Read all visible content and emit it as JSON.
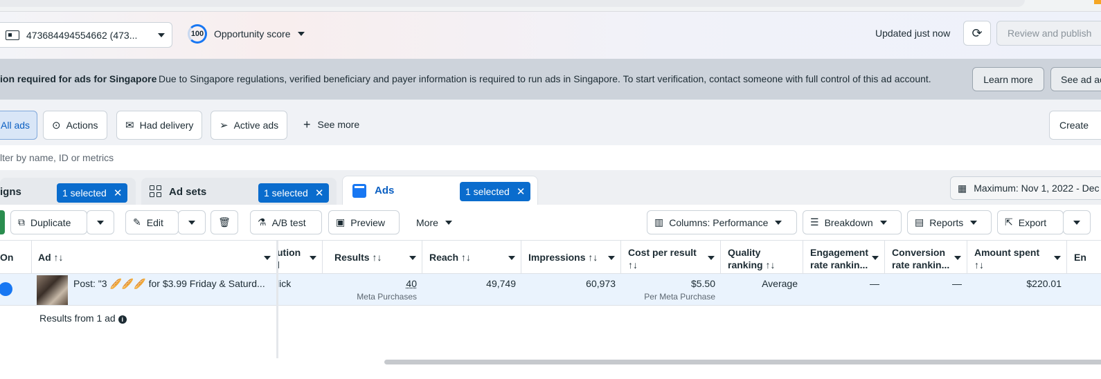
{
  "topbar": {
    "account_label": "473684494554662 (473...",
    "opportunity_score": "100",
    "opportunity_label": "Opportunity score",
    "updated_text": "Updated just now",
    "review_label": "Review and publish"
  },
  "banner": {
    "title": "ion required for ads for Singapore",
    "message": "Due to Singapore regulations, verified beneficiary and payer information is required to run ads in Singapore. To start verification, contact someone with full control of this ad account.",
    "learn_more": "Learn more",
    "see_ad": "See ad account"
  },
  "filters": {
    "all_ads": "All ads",
    "actions": "Actions",
    "had_delivery": "Had delivery",
    "active_ads": "Active ads",
    "see_more": "See more",
    "create": "Create"
  },
  "search": {
    "placeholder": "lter by name, ID or metrics"
  },
  "tabs": {
    "campaigns": "igns",
    "campaigns_badge": "1 selected",
    "adsets": "Ad sets",
    "adsets_badge": "1 selected",
    "ads": "Ads",
    "ads_badge": "1 selected",
    "date_range": "Maximum: Nov 1, 2022 - Dec"
  },
  "toolbar": {
    "duplicate": "Duplicate",
    "edit": "Edit",
    "ab_test": "A/B test",
    "preview": "Preview",
    "more": "More",
    "columns": "Columns: Performance",
    "breakdown": "Breakdown",
    "reports": "Reports",
    "export": "Export"
  },
  "table": {
    "headers": {
      "on": "On",
      "ad": "Ad ↑↓",
      "attribution_line1": "ution",
      "attribution_line2": "l",
      "results": "Results ↑↓",
      "reach": "Reach ↑↓",
      "impressions": "Impressions ↑↓",
      "cost_line1": "Cost per result",
      "cost_line2": "↑↓",
      "quality_line1": "Quality",
      "quality_line2": "ranking ↑↓",
      "engagement_line1": "Engagement",
      "engagement_line2": "rate rankin...",
      "conversion_line1": "Conversion",
      "conversion_line2": "rate rankin...",
      "amount_line1": "Amount spent",
      "amount_line2": "↑↓",
      "ends": "En"
    },
    "row": {
      "ad_name": "Post: \"3 🥖🥖🥖 for $3.99 Friday & Saturd...",
      "attribution": "lick",
      "results": "40",
      "results_sub": "Meta Purchases",
      "reach": "49,749",
      "impressions": "60,973",
      "cost": "$5.50",
      "cost_sub": "Per Meta Purchase",
      "quality": "Average",
      "engagement": "—",
      "conversion": "—",
      "amount": "$220.01"
    },
    "footer": "Results from 1 ad"
  }
}
